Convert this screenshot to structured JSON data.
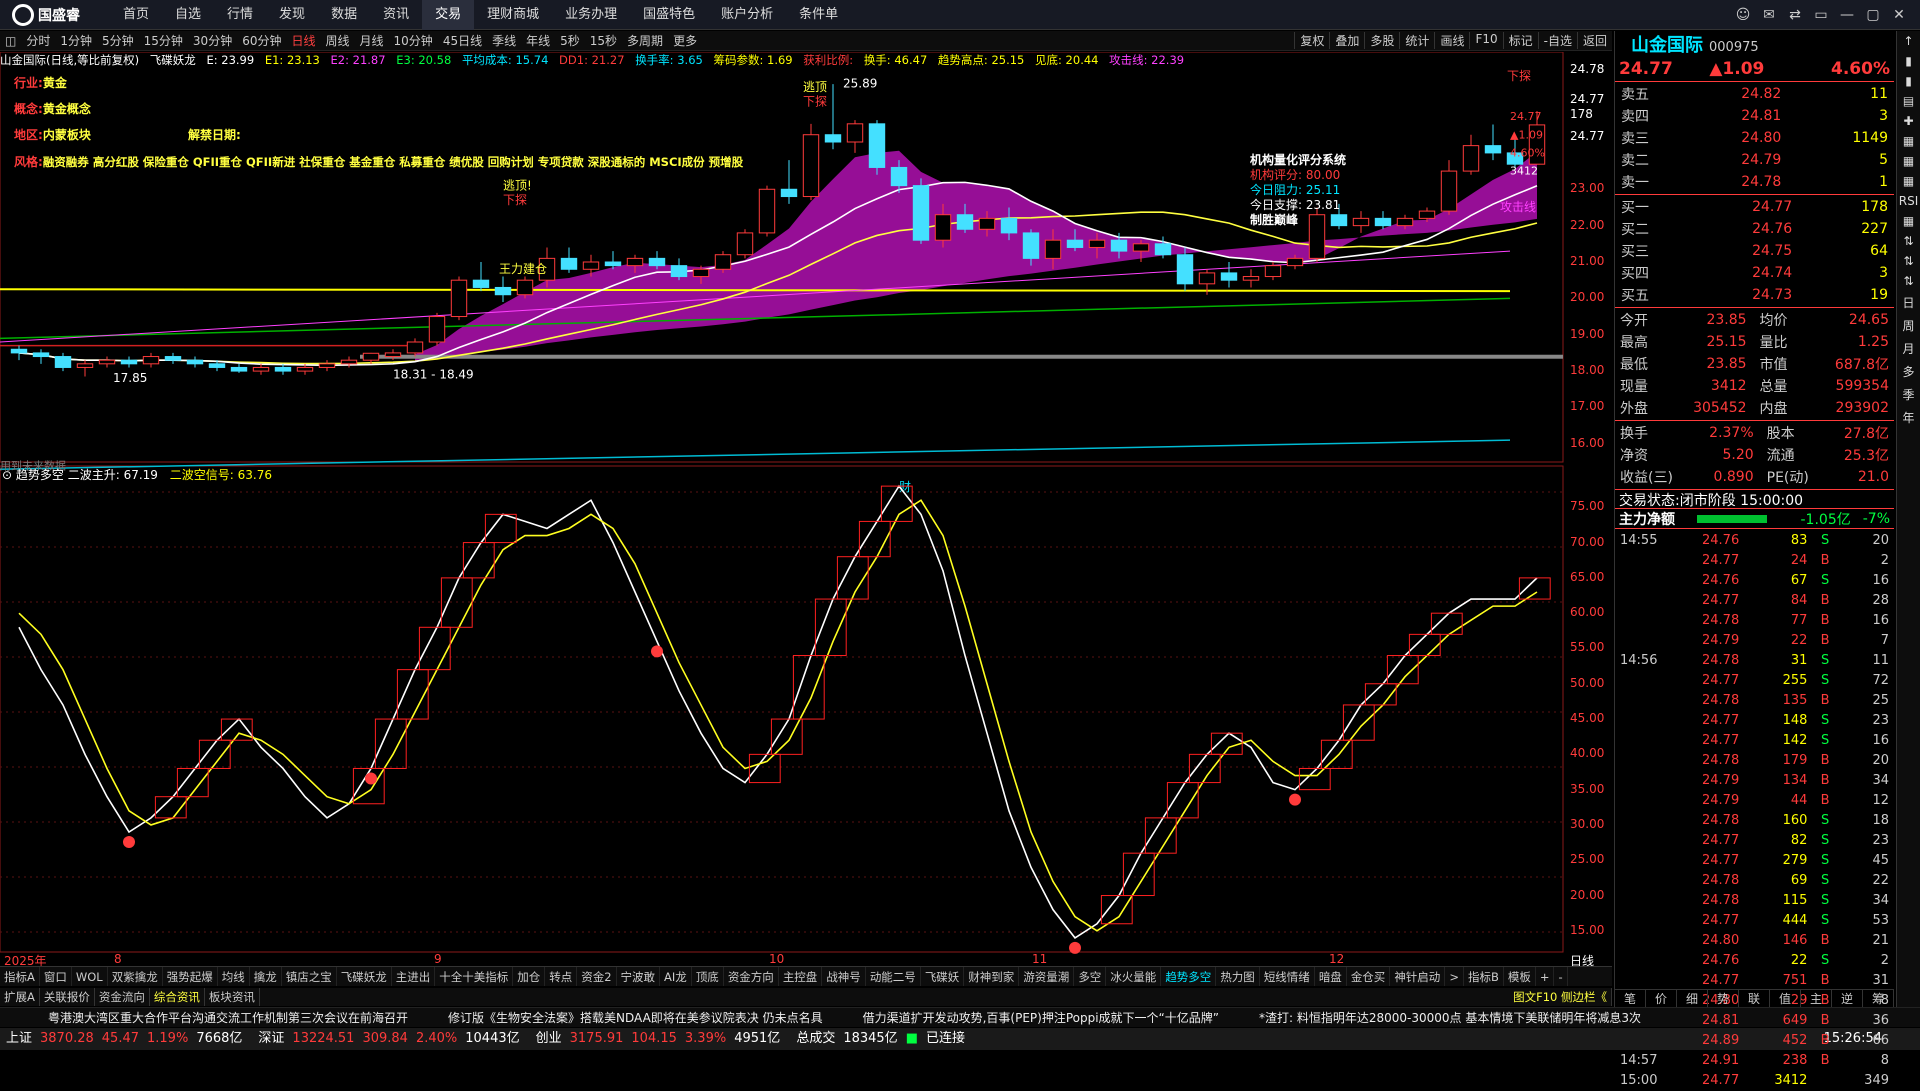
{
  "app": {
    "brand": "国盛睿"
  },
  "menu": [
    "首页",
    "自选",
    "行情",
    "发现",
    "数据",
    "资讯",
    "交易",
    "理财商城",
    "业务办理",
    "国盛特色",
    "账户分析",
    "条件单"
  ],
  "menu_active": 6,
  "window_controls": [
    "☺",
    "✉",
    "⇄",
    "▭",
    "—",
    "▢",
    "✕"
  ],
  "periods": [
    "分时",
    "1分钟",
    "5分钟",
    "15分钟",
    "30分钟",
    "60分钟",
    "日线",
    "周线",
    "月线",
    "10分钟",
    "45日线",
    "季线",
    "年线",
    "5秒",
    "15秒",
    "多周期",
    "更多"
  ],
  "period_active": 6,
  "toolbar_right": [
    "复权",
    "叠加",
    "多股",
    "统计",
    "画线",
    "F10",
    "标记",
    "-自选",
    "返回"
  ],
  "kinfo": {
    "title": "山金国际(日线,等比前复权)",
    "indicator": "飞碟妖龙",
    "E": "E: 23.99",
    "E1": "E1: 23.13",
    "E2": "E2: 21.87",
    "E3": "E3: 20.58",
    "avgcost": "平均成本: 15.74",
    "DD1": "DD1: 21.27",
    "turnover_rate": "换手率: 3.65",
    "chip": "筹码参数: 1.69",
    "profit": "获利比例:",
    "hands": "换手: 46.47",
    "trend_high": "趋势高点: 25.15",
    "see_top": "见底: 20.44",
    "attack": "攻击线: 22.39"
  },
  "stock_meta": {
    "industry_label": "行业:",
    "industry": "黄金",
    "concept_label": "概念:",
    "concept": "黄金概念",
    "region_label": "地区:",
    "region": "内蒙板块",
    "ban_label": "解禁日期:",
    "style_label": "风格:",
    "style": "融资融券 高分红股 保险重仓 QFII重仓 QFII新进 社保重仓 基金重仓 私募重仓 绩优股 回购计划 专项贷款 深股通标的 MSCI成份 预增股"
  },
  "annotations": {
    "escape1": "逃顶",
    "down1": "下探",
    "escape2": "逃顶!",
    "down2": "下探",
    "down3": "下探",
    "high_label": "25.89",
    "low_label": "17.85",
    "range_label": "18.31 - 18.49",
    "main_force": "王力建仓",
    "attack_label": "攻击线",
    "future_label": "用到未来数据",
    "fin_label": "财",
    "quant_title": "机构量化评分系统",
    "quant_score": "机构评分: 80.00",
    "pressure": "今日阻力: 25.11",
    "support": "今日支撑: 23.81",
    "win": "制胜巅峰",
    "price_24_77": "24.77",
    "price_1_09": "▲1.09",
    "pct_4_60": "4.60%",
    "vol_3412": "3412"
  },
  "upper_axis": [
    "24.78",
    "24.77",
    "178",
    "24.77",
    "23.00",
    "22.00",
    "21.00",
    "20.00",
    "19.00",
    "18.00",
    "17.00",
    "16.00"
  ],
  "upper_axis_prices": [
    null,
    null,
    null,
    null,
    23.0,
    22.0,
    21.0,
    20.0,
    19.0,
    18.0,
    17.0,
    16.0
  ],
  "lower_title": "趋势多空",
  "lower_ind1": "二波主升: 67.19",
  "lower_ind2": "二波空信号: 63.76",
  "lower_axis": [
    "75.00",
    "70.00",
    "65.00",
    "60.00",
    "55.00",
    "50.00",
    "45.00",
    "40.00",
    "35.00",
    "30.00",
    "25.00",
    "20.00",
    "15.00"
  ],
  "lower_axis_values": [
    75,
    70,
    65,
    60,
    55,
    50,
    45,
    40,
    35,
    30,
    25,
    20,
    15
  ],
  "months": [
    "2025年",
    "8",
    "9",
    "10",
    "11",
    "12"
  ],
  "period_corner": "日线",
  "bottom_tabs": [
    "指标A",
    "窗口",
    "WOL",
    "双紫擒龙",
    "强势起爆",
    "均线",
    "擒龙",
    "镇店之宝",
    "飞碟妖龙",
    "主进出",
    "十全十美指标",
    "加仓",
    "转点",
    "资金2",
    "宁波敢",
    "AI龙",
    "顶底",
    "资金方向",
    "主控盘",
    "战神号",
    "动能二号",
    "飞碟妖",
    "财神到家",
    "游资量潮",
    "多空",
    "冰火量能",
    "趋势多空",
    "热力图",
    "短线情绪",
    "暗盘",
    "金仓买",
    "神针启动",
    ">",
    "指标B",
    "模板",
    "+",
    "-"
  ],
  "bottom_tab_active": 26,
  "bottom_tabs2": [
    "扩展A",
    "关联报价",
    "资金流向",
    "综合资讯",
    "板块资讯"
  ],
  "bottom_tabs2_right": "图文F10 侧边栏《",
  "news": [
    "粤港澳大湾区重大合作平台沟通交流工作机制第三次会议在前海召开",
    "修订版《生物安全法案》搭载美NDAA即将在美参议院表决 仍未点名具",
    "借力渠道扩开发动攻势,百事(PEP)押注Poppi成就下一个“十亿品牌”",
    "*渣打: 料恒指明年达28000-30000点 基本情境下美联储明年将减息3次"
  ],
  "status": {
    "sh_label": "上证",
    "sh": "3870.28",
    "sh_chg": "45.47",
    "sh_pct": "1.19%",
    "sh_amt": "7668亿",
    "sz_label": "深证",
    "sz": "13224.51",
    "sz_chg": "309.84",
    "sz_pct": "2.40%",
    "sz_amt": "10443亿",
    "cy_label": "创业",
    "cy": "3175.91",
    "cy_chg": "104.15",
    "cy_pct": "3.39%",
    "cy_amt": "4951亿",
    "total_label": "总成交",
    "total": "18345亿",
    "conn": "已连接",
    "time": "15:26:54"
  },
  "quote": {
    "name": "山金国际",
    "code": "000975",
    "price": "24.77",
    "change": "▲1.09",
    "pct": "4.60%",
    "asks": [
      [
        "卖五",
        "24.82",
        "11"
      ],
      [
        "卖四",
        "24.81",
        "3"
      ],
      [
        "卖三",
        "24.80",
        "1149"
      ],
      [
        "卖二",
        "24.79",
        "5"
      ],
      [
        "卖一",
        "24.78",
        "1"
      ]
    ],
    "bids": [
      [
        "买一",
        "24.77",
        "178"
      ],
      [
        "买二",
        "24.76",
        "227"
      ],
      [
        "买三",
        "24.75",
        "64"
      ],
      [
        "买四",
        "24.74",
        "3"
      ],
      [
        "买五",
        "24.73",
        "19"
      ]
    ],
    "stats": [
      [
        "今开",
        "23.85",
        "均价",
        "24.65"
      ],
      [
        "最高",
        "25.15",
        "量比",
        "1.25"
      ],
      [
        "最低",
        "23.85",
        "市值",
        "687.8亿"
      ],
      [
        "现量",
        "3412",
        "总量",
        "599354"
      ],
      [
        "外盘",
        "305452",
        "内盘",
        "293902"
      ]
    ],
    "stats2": [
      [
        "换手",
        "2.37%",
        "股本",
        "27.8亿"
      ],
      [
        "净资",
        "5.20",
        "流通",
        "25.3亿"
      ],
      [
        "收益(三)",
        "0.890",
        "PE(动)",
        "21.0"
      ]
    ],
    "trade_state_label": "交易状态:",
    "trade_state": "闭市阶段 15:00:00",
    "main_net_label": "主力净额",
    "main_net": "-1.05亿",
    "main_net_pct": "-7%",
    "ticks": [
      [
        "14:55",
        "24.76",
        "83",
        "S",
        "20"
      ],
      [
        "",
        "24.77",
        "24",
        "B",
        "2"
      ],
      [
        "",
        "24.76",
        "67",
        "S",
        "16"
      ],
      [
        "",
        "24.77",
        "84",
        "B",
        "28"
      ],
      [
        "",
        "24.78",
        "77",
        "B",
        "16"
      ],
      [
        "",
        "24.79",
        "22",
        "B",
        "7"
      ],
      [
        "14:56",
        "24.78",
        "31",
        "S",
        "11"
      ],
      [
        "",
        "24.77",
        "255",
        "S",
        "72"
      ],
      [
        "",
        "24.78",
        "135",
        "B",
        "25"
      ],
      [
        "",
        "24.77",
        "148",
        "S",
        "23"
      ],
      [
        "",
        "24.77",
        "142",
        "S",
        "16"
      ],
      [
        "",
        "24.78",
        "179",
        "B",
        "20"
      ],
      [
        "",
        "24.79",
        "134",
        "B",
        "34"
      ],
      [
        "",
        "24.79",
        "44",
        "B",
        "12"
      ],
      [
        "",
        "24.78",
        "160",
        "S",
        "18"
      ],
      [
        "",
        "24.77",
        "82",
        "S",
        "23"
      ],
      [
        "",
        "24.77",
        "279",
        "S",
        "45"
      ],
      [
        "",
        "24.78",
        "69",
        "S",
        "22"
      ],
      [
        "",
        "24.78",
        "115",
        "S",
        "34"
      ],
      [
        "",
        "24.77",
        "444",
        "S",
        "53"
      ],
      [
        "",
        "24.80",
        "146",
        "B",
        "21"
      ],
      [
        "",
        "24.76",
        "22",
        "S",
        "2"
      ],
      [
        "",
        "24.77",
        "751",
        "B",
        "31"
      ],
      [
        "",
        "24.80",
        "29",
        "B",
        "8"
      ],
      [
        "",
        "24.81",
        "649",
        "B",
        "36"
      ],
      [
        "",
        "24.89",
        "452",
        "B",
        "66"
      ],
      [
        "14:57",
        "24.91",
        "238",
        "B",
        "8"
      ],
      [
        "15:00",
        "24.77",
        "3412",
        "",
        "349"
      ]
    ],
    "bottom_tabs": [
      "笔",
      "价",
      "细",
      "势",
      "联",
      "值",
      "主",
      "逆",
      "筹"
    ]
  },
  "sidetool": [
    "↑",
    "▮",
    "▮",
    "▤",
    "✚",
    "▦",
    "▦",
    "▦",
    "RSI",
    "▦",
    "⇅",
    "⇅",
    "⇅",
    "日",
    "周",
    "月",
    "多",
    "季",
    "年"
  ],
  "chart_data": {
    "type": "candlestick",
    "candles": [
      [
        18.6,
        18.7,
        18.3,
        18.5
      ],
      [
        18.5,
        18.6,
        18.2,
        18.4
      ],
      [
        18.4,
        18.5,
        18.0,
        18.1
      ],
      [
        18.1,
        18.3,
        17.85,
        18.2
      ],
      [
        18.2,
        18.4,
        18.1,
        18.3
      ],
      [
        18.3,
        18.4,
        18.1,
        18.2
      ],
      [
        18.2,
        18.5,
        18.1,
        18.4
      ],
      [
        18.4,
        18.5,
        18.2,
        18.3
      ],
      [
        18.3,
        18.4,
        18.1,
        18.2
      ],
      [
        18.2,
        18.3,
        18.0,
        18.1
      ],
      [
        18.1,
        18.2,
        17.95,
        18.0
      ],
      [
        18.0,
        18.2,
        17.9,
        18.1
      ],
      [
        18.1,
        18.2,
        17.9,
        18.0
      ],
      [
        18.0,
        18.2,
        17.9,
        18.1
      ],
      [
        18.1,
        18.3,
        18.0,
        18.2
      ],
      [
        18.2,
        18.4,
        18.1,
        18.3
      ],
      [
        18.3,
        18.5,
        18.2,
        18.49
      ],
      [
        18.4,
        18.6,
        18.31,
        18.5
      ],
      [
        18.5,
        18.9,
        18.4,
        18.8
      ],
      [
        18.8,
        19.6,
        18.7,
        19.5
      ],
      [
        19.5,
        20.6,
        19.4,
        20.5
      ],
      [
        20.5,
        21.0,
        20.2,
        20.3
      ],
      [
        20.3,
        20.6,
        19.9,
        20.1
      ],
      [
        20.1,
        20.6,
        20.0,
        20.5
      ],
      [
        20.5,
        21.4,
        20.3,
        21.1
      ],
      [
        21.1,
        21.4,
        20.7,
        20.8
      ],
      [
        20.8,
        21.2,
        20.6,
        21.0
      ],
      [
        21.0,
        21.3,
        20.8,
        20.9
      ],
      [
        20.9,
        21.2,
        20.7,
        21.1
      ],
      [
        21.1,
        21.3,
        20.8,
        20.9
      ],
      [
        20.9,
        21.1,
        20.5,
        20.6
      ],
      [
        20.6,
        20.9,
        20.4,
        20.8
      ],
      [
        20.8,
        21.3,
        20.7,
        21.2
      ],
      [
        21.2,
        21.9,
        21.1,
        21.8
      ],
      [
        21.8,
        23.1,
        21.7,
        23.0
      ],
      [
        23.0,
        23.8,
        22.6,
        22.8
      ],
      [
        22.8,
        24.8,
        22.7,
        24.5
      ],
      [
        24.5,
        25.89,
        24.1,
        24.3
      ],
      [
        24.3,
        24.9,
        24.0,
        24.8
      ],
      [
        24.8,
        24.9,
        23.4,
        23.6
      ],
      [
        23.6,
        23.8,
        22.9,
        23.1
      ],
      [
        23.1,
        23.3,
        21.5,
        21.6
      ],
      [
        21.6,
        22.6,
        21.4,
        22.3
      ],
      [
        22.3,
        22.6,
        21.8,
        21.9
      ],
      [
        21.9,
        22.4,
        21.7,
        22.2
      ],
      [
        22.2,
        22.5,
        21.6,
        21.8
      ],
      [
        21.8,
        21.9,
        20.9,
        21.1
      ],
      [
        21.1,
        21.9,
        20.8,
        21.6
      ],
      [
        21.6,
        21.9,
        21.3,
        21.4
      ],
      [
        21.4,
        21.8,
        21.1,
        21.6
      ],
      [
        21.6,
        21.8,
        21.1,
        21.3
      ],
      [
        21.3,
        21.6,
        21.0,
        21.5
      ],
      [
        21.5,
        21.7,
        21.1,
        21.2
      ],
      [
        21.2,
        21.4,
        20.2,
        20.4
      ],
      [
        20.4,
        20.8,
        20.1,
        20.7
      ],
      [
        20.7,
        21.0,
        20.3,
        20.5
      ],
      [
        20.5,
        20.8,
        20.3,
        20.6
      ],
      [
        20.6,
        21.0,
        20.5,
        20.9
      ],
      [
        20.9,
        21.2,
        20.8,
        21.1
      ],
      [
        21.1,
        22.5,
        21.0,
        22.3
      ],
      [
        22.3,
        22.6,
        21.9,
        22.0
      ],
      [
        22.0,
        22.4,
        21.8,
        22.2
      ],
      [
        22.2,
        22.4,
        21.9,
        22.0
      ],
      [
        22.0,
        22.3,
        21.9,
        22.2
      ],
      [
        22.2,
        22.5,
        22.1,
        22.4
      ],
      [
        22.4,
        23.8,
        22.3,
        23.5
      ],
      [
        23.5,
        24.5,
        23.4,
        24.2
      ],
      [
        24.2,
        24.78,
        23.8,
        24.0
      ],
      [
        24.0,
        24.4,
        23.6,
        23.69
      ],
      [
        23.69,
        25.15,
        23.85,
        24.77
      ]
    ],
    "upper_ylim": [
      15.5,
      26.5
    ],
    "lower_series": [
      {
        "name": "二波主升",
        "values": [
          58,
          52,
          47,
          40,
          34,
          29,
          31,
          34,
          38,
          42,
          45,
          41,
          38,
          34,
          31,
          33,
          38,
          45,
          52,
          58,
          65,
          70,
          74,
          73,
          72,
          74,
          76,
          70,
          63,
          56,
          49,
          43,
          38,
          36,
          40,
          45,
          54,
          62,
          68,
          73,
          78,
          74,
          66,
          54,
          43,
          32,
          24,
          18,
          14,
          16,
          20,
          26,
          31,
          36,
          40,
          43,
          41,
          36,
          35,
          38,
          42,
          47,
          50,
          54,
          57,
          60,
          62,
          62,
          62,
          65
        ]
      },
      {
        "name": "二波空信号",
        "values": [
          60,
          57,
          52,
          45,
          38,
          32,
          30,
          31,
          35,
          39,
          43,
          42,
          40,
          37,
          34,
          33,
          35,
          40,
          46,
          52,
          58,
          64,
          69,
          71,
          71,
          72,
          74,
          72,
          67,
          60,
          53,
          47,
          41,
          38,
          39,
          42,
          48,
          56,
          63,
          68,
          74,
          76,
          71,
          61,
          50,
          39,
          29,
          22,
          17,
          15,
          17,
          22,
          27,
          32,
          37,
          41,
          42,
          39,
          37,
          37,
          40,
          44,
          47,
          51,
          54,
          57,
          59,
          61,
          61,
          63
        ]
      }
    ],
    "lower_ylim": [
      12,
      80
    ]
  }
}
